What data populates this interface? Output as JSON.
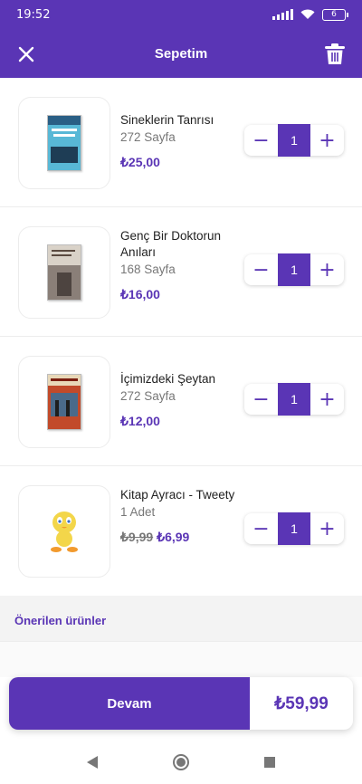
{
  "status_bar": {
    "time": "19:52",
    "battery": "6"
  },
  "header": {
    "title": "Sepetim"
  },
  "items": [
    {
      "title": "Sineklerin Tanrısı",
      "subtitle": "272 Sayfa",
      "price": "₺25,00",
      "quantity": "1",
      "cover_color": "#58b8d6"
    },
    {
      "title": "Genç Bir Doktorun Anıları",
      "subtitle": "168 Sayfa",
      "price": "₺16,00",
      "quantity": "1",
      "cover_color": "#8a7f78"
    },
    {
      "title": "İçimizdeki Şeytan",
      "subtitle": "272 Sayfa",
      "price": "₺12,00",
      "quantity": "1",
      "cover_color": "#c24a2a"
    },
    {
      "title": "Kitap Ayracı - Tweety",
      "subtitle": "1 Adet",
      "old_price": "₺9,99",
      "price": "₺6,99",
      "quantity": "1",
      "cover_color": "#f3d64a"
    }
  ],
  "stepper": {
    "minus": "−",
    "plus": "+"
  },
  "suggestions": {
    "title": "Önerilen ürünler"
  },
  "checkout": {
    "button_label": "Devam",
    "total": "₺59,99"
  },
  "colors": {
    "primary": "#5a35b5",
    "muted": "#777777"
  },
  "icons": {
    "close": "close-icon",
    "delete": "trash-icon",
    "back": "back-icon",
    "home": "home-icon",
    "recents": "recents-icon"
  }
}
